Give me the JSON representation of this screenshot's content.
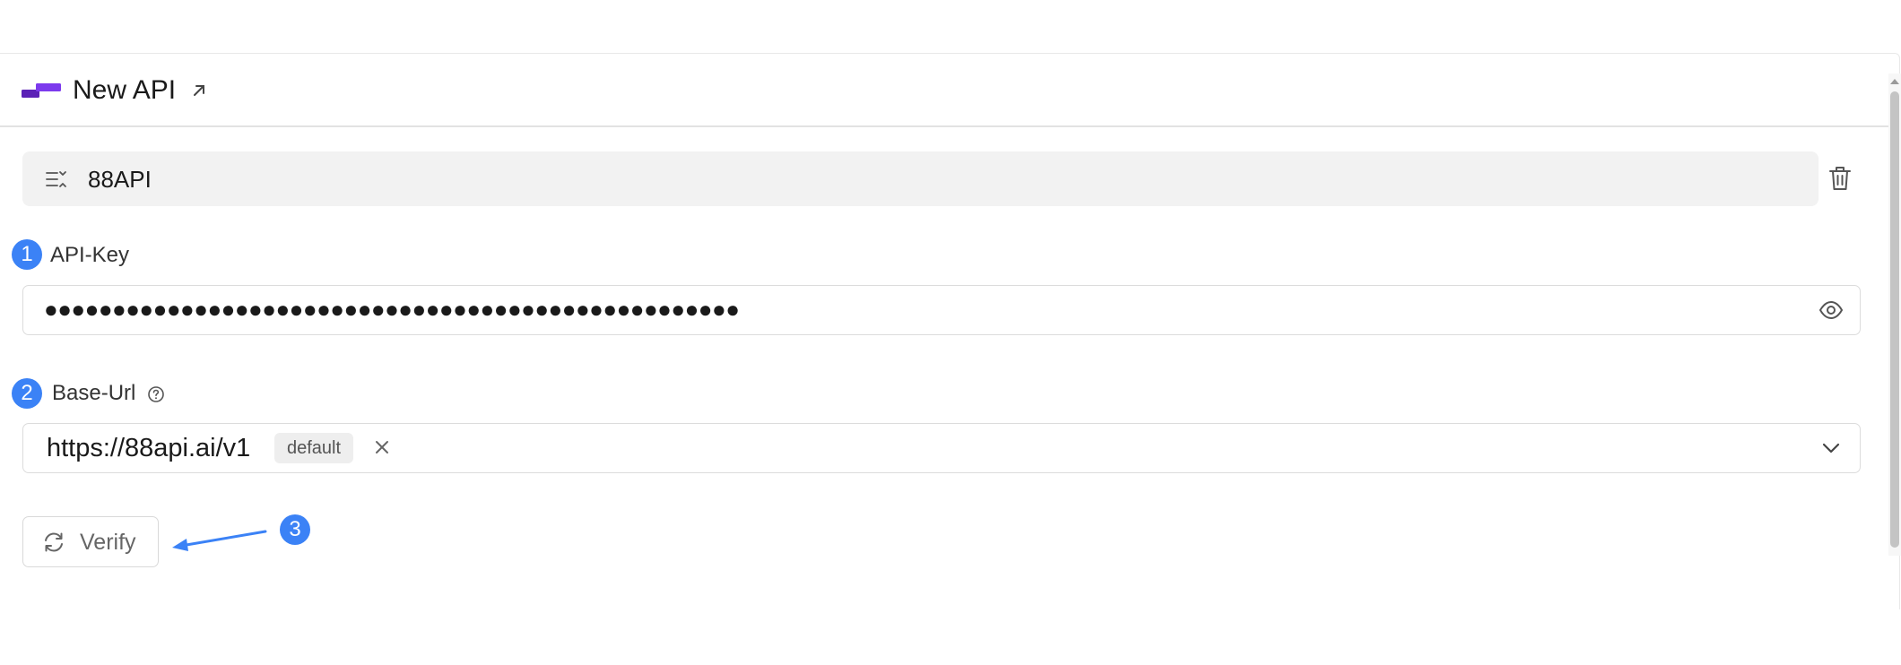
{
  "header": {
    "title": "New API",
    "logo_icon": "stacked-bars-logo",
    "link_icon": "arrow-up-right-icon"
  },
  "provider": {
    "name": "88API"
  },
  "api_key": {
    "step": "1",
    "label": "API-Key",
    "value_masked": "●●●●●●●●●●●●●●●●●●●●●●●●●●●●●●●●●●●●●●●●●●●●●●●●●●●"
  },
  "base_url": {
    "step": "2",
    "label": "Base-Url",
    "value": "https://88api.ai/v1",
    "tag": "default"
  },
  "verify": {
    "step": "3",
    "label": "Verify"
  },
  "colors": {
    "accent": "#3b82f6",
    "logo_dark": "#5b21b6",
    "logo_light": "#7c3aed"
  }
}
